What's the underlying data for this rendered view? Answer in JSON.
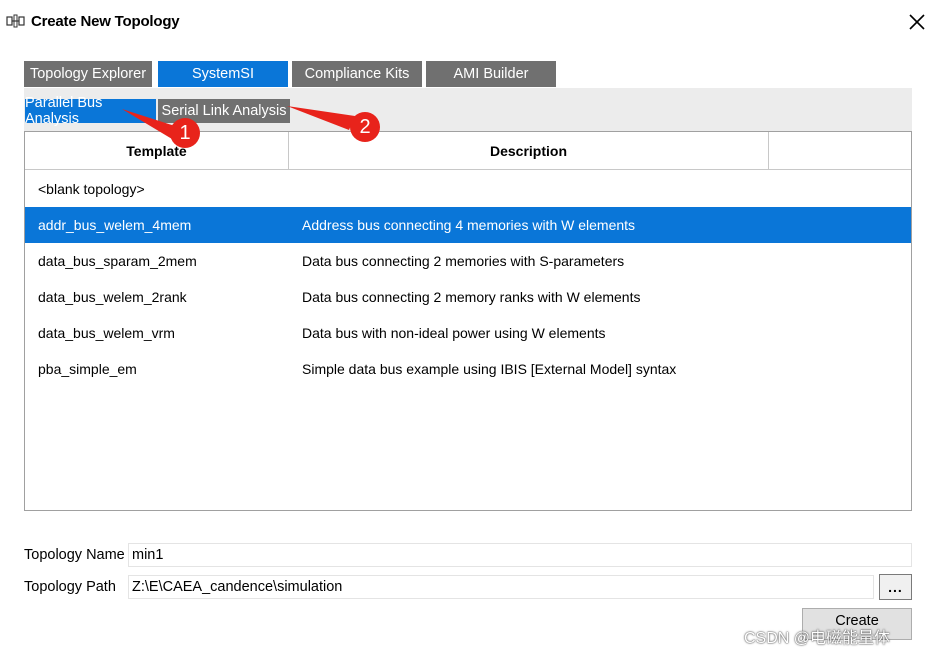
{
  "window": {
    "title": "Create New Topology",
    "close_glyph": "✕"
  },
  "main_tabs": [
    {
      "label": "Topology Explorer",
      "active": false
    },
    {
      "label": "SystemSI",
      "active": true
    },
    {
      "label": "Compliance Kits",
      "active": false
    },
    {
      "label": "AMI Builder",
      "active": false
    }
  ],
  "sub_tabs": [
    {
      "label": "Parallel Bus Analysis",
      "active": true
    },
    {
      "label": "Serial Link Analysis",
      "active": false
    }
  ],
  "table": {
    "columns": [
      "Template",
      "Description",
      ""
    ],
    "rows": [
      {
        "template": "<blank topology>",
        "description": "",
        "selected": false
      },
      {
        "template": "addr_bus_welem_4mem",
        "description": "Address bus connecting 4 memories with W elements",
        "selected": true
      },
      {
        "template": "data_bus_sparam_2mem",
        "description": "Data bus connecting 2 memories with S-parameters",
        "selected": false
      },
      {
        "template": "data_bus_welem_2rank",
        "description": "Data bus connecting 2 memory ranks with W elements",
        "selected": false
      },
      {
        "template": "data_bus_welem_vrm",
        "description": "Data bus with non-ideal power using W elements",
        "selected": false
      },
      {
        "template": "pba_simple_em",
        "description": "Simple data bus example using IBIS [External Model] syntax",
        "selected": false
      }
    ]
  },
  "form": {
    "name_label": "Topology Name",
    "name_value": "min1",
    "path_label": "Topology Path",
    "path_value": "Z:\\E\\CAEA_candence\\simulation",
    "browse_label": "...",
    "create_label": "Create"
  },
  "annotations": {
    "badge_1": "1",
    "badge_2": "2",
    "color": "#e8231b"
  },
  "watermark": "CSDN @电磁能量体",
  "colors": {
    "accent": "#0a76d8",
    "tab_inactive": "#707070"
  },
  "icons": {
    "title": "topology-app-icon",
    "close": "close-icon"
  }
}
